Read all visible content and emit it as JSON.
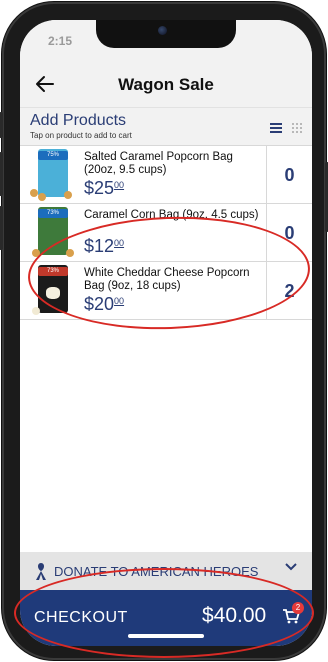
{
  "statusbar": {
    "time": "2:15",
    "battery": "▬"
  },
  "header": {
    "back_icon": "arrow-left-icon",
    "title": "Wagon Sale"
  },
  "section": {
    "title": "Add Products",
    "subtitle": "Tap on product to add to cart"
  },
  "products": [
    {
      "name": "Salted Caramel Popcorn Bag (20oz, 9.5 cups)",
      "price_main": "$25",
      "price_cents": "00",
      "qty": "0",
      "color": "#4bb0d8"
    },
    {
      "name": "Caramel Corn Bag (9oz, 4.5 cups)",
      "price_main": "$12",
      "price_cents": "00",
      "qty": "0",
      "color": "#3e7a3b"
    },
    {
      "name": "White Cheddar Cheese Popcorn Bag (9oz, 18 cups)",
      "price_main": "$20",
      "price_cents": "00",
      "qty": "2",
      "color": "#1b1b1b"
    }
  ],
  "donate": {
    "label": "DONATE TO AMERICAN HEROES"
  },
  "checkout": {
    "label": "CHECKOUT",
    "total": "$40.00",
    "cart_count": "2"
  },
  "colors": {
    "brand_navy": "#1f3a7a",
    "accent_text": "#2a3d75",
    "badge_red": "#e63a3a",
    "annotation_red": "#d82a25"
  }
}
